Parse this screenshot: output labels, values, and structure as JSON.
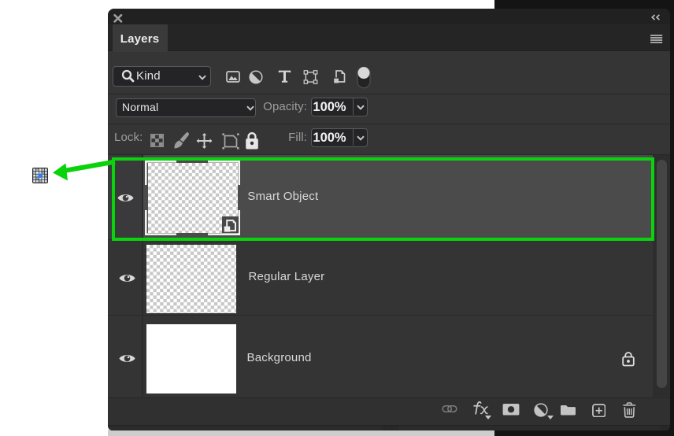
{
  "window": {
    "close_label": "x",
    "collapse_icon": "double-chevron-left",
    "panel_menu_icon": "hamburger-menu"
  },
  "panel": {
    "tab_label": "Layers",
    "filter_bar": {
      "search_field_value": "Kind",
      "search_icon": "magnifier",
      "filter_icons": [
        "pixel-layer-filter",
        "adjustment-layer-filter",
        "type-layer-filter",
        "shape-layer-filter",
        "smart-object-filter"
      ],
      "filter_toggle": "filtering-toggle-on"
    },
    "blend_row": {
      "blend_mode_value": "Normal",
      "opacity_label": "Opacity:",
      "opacity_value": "100%"
    },
    "lock_row": {
      "lock_label": "Lock:",
      "lock_icons": [
        "lock-transparent-pixels",
        "lock-image-pixels-brush",
        "lock-position-move",
        "lock-artboard-nesting",
        "lock-all-padlock"
      ],
      "fill_label": "Fill:",
      "fill_value": "100%"
    },
    "layers": [
      {
        "name": "Smart Object",
        "selected": true,
        "badge": "smart-object-badge",
        "thumbnail": "transparent-checkerboard",
        "visible": true
      },
      {
        "name": "Regular Layer",
        "selected": false,
        "thumbnail": "transparent-checkerboard",
        "visible": true
      },
      {
        "name": "Background",
        "selected": false,
        "thumbnail": "white",
        "visible": true,
        "locked": true
      }
    ],
    "footer_icons": [
      "link-layers",
      "layer-effects-fx",
      "add-layer-mask",
      "new-adjustment-layer",
      "new-group-folder",
      "new-layer-plus",
      "delete-layer-trash"
    ]
  },
  "annotation": {
    "highlight_color": "#0bd30b",
    "arrow": "points-left-to-grid-icon",
    "grid_icon": "pixel-grid-icon-with-blue-center"
  },
  "colors": {
    "canvas_background": "#ffffff",
    "app_background": "#141414",
    "panel_background": "#353535",
    "selected_row": "#4b4b4b",
    "field_border": "#57585a",
    "accent_blue": "#2f7cf6"
  }
}
